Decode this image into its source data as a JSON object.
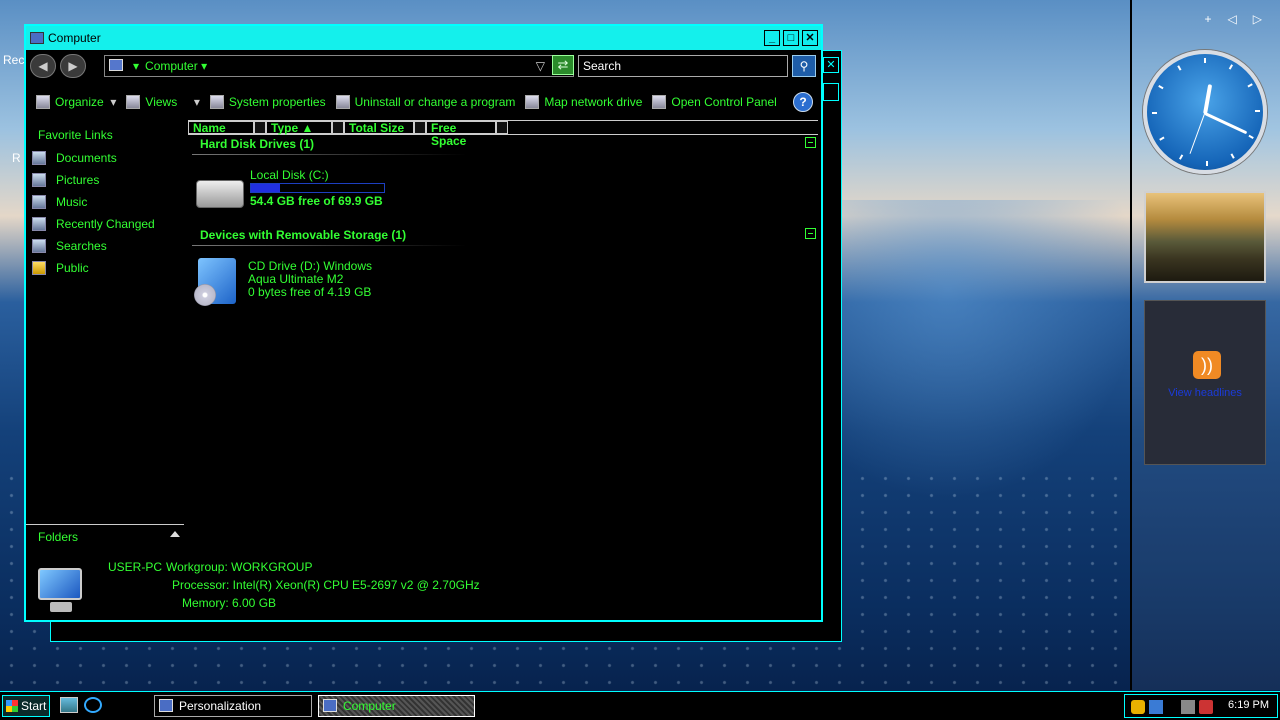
{
  "desktop": {
    "recycle_label": "Rec",
    "r_label": "R"
  },
  "gadgets": {
    "rss_text": "View headlines"
  },
  "window": {
    "title": "Computer",
    "minimize": "_",
    "maximize": "□",
    "close": "✕",
    "breadcrumb": "Computer",
    "search_placeholder": "Search",
    "toolbar": {
      "organize": "Organize",
      "views": "Views",
      "system_properties": "System properties",
      "uninstall": "Uninstall or change a program",
      "map_drive": "Map network drive",
      "control_panel": "Open Control Panel"
    },
    "favorite_links": {
      "heading": "Favorite Links",
      "items": [
        "Documents",
        "Pictures",
        "Music",
        "Recently Changed",
        "Searches",
        "Public"
      ]
    },
    "columns": [
      "Name",
      "Type",
      "Total Size",
      "Free Space"
    ],
    "groups": {
      "hdd": "Hard Disk Drives (1)",
      "removable": "Devices with Removable Storage (1)"
    },
    "drives": {
      "c_name": "Local Disk (C:)",
      "c_free": "54.4 GB free of 69.9 GB",
      "c_used_fraction": 0.22,
      "d_line1": "CD Drive (D:) Windows",
      "d_line2": "Aqua Ultimate M2",
      "d_free": "0 bytes free of 4.19 GB"
    },
    "folders_label": "Folders",
    "details": {
      "pc_name": "USER-PC",
      "workgroup": "Workgroup: WORKGROUP",
      "processor": "Processor: Intel(R) Xeon(R) CPU E5-2697 v2 @ 2.70GHz",
      "memory": "Memory: 6.00 GB"
    }
  },
  "taskbar": {
    "start": "Start",
    "tasks": [
      "Personalization",
      "Computer"
    ],
    "clock": "6:19 PM"
  }
}
